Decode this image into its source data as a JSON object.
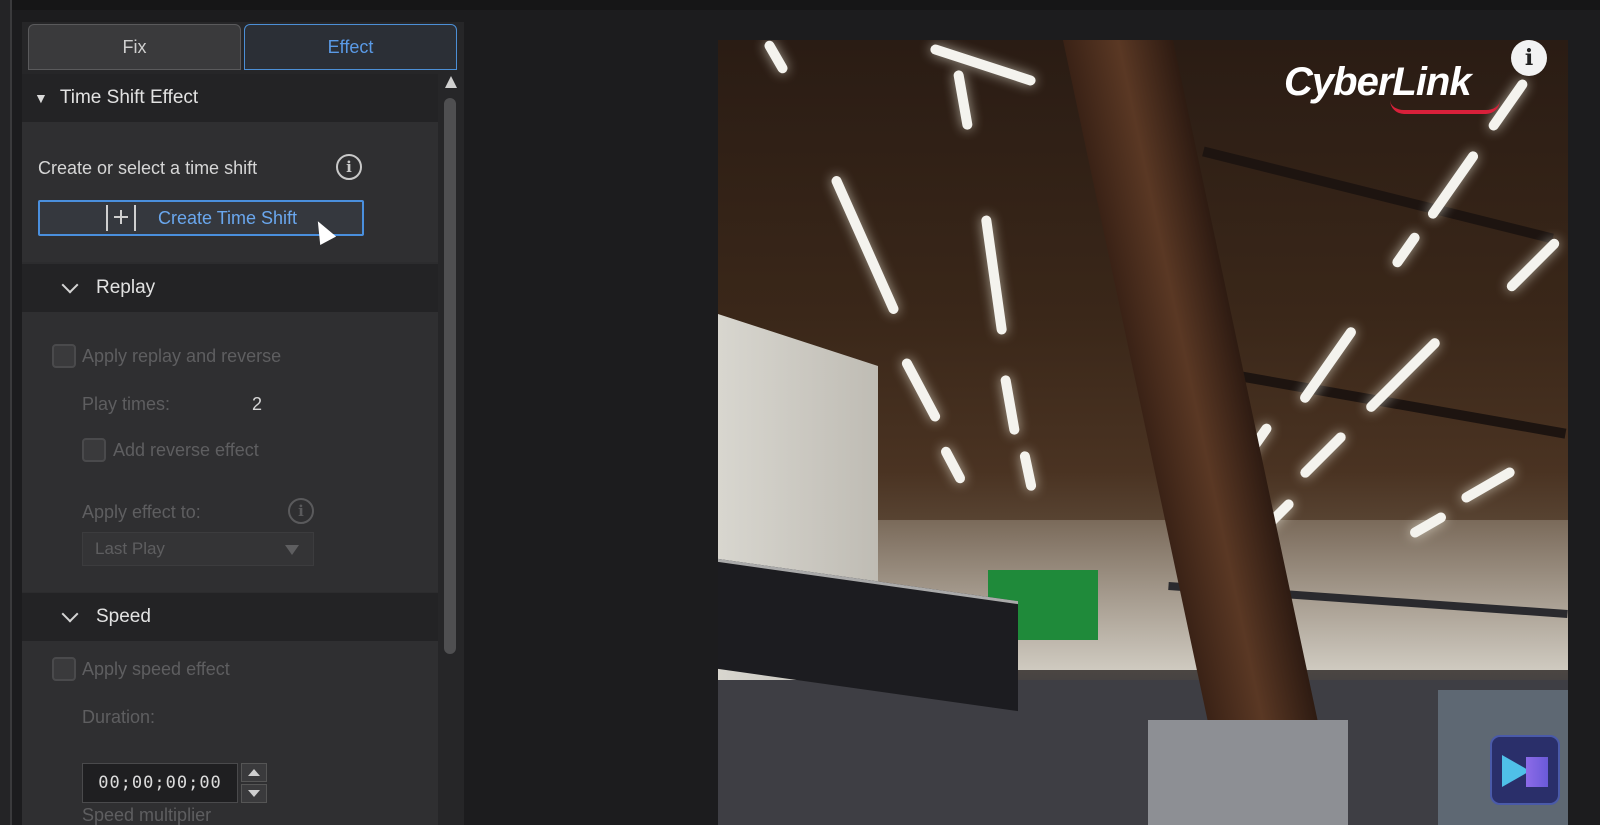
{
  "tabs": {
    "fix": "Fix",
    "effect": "Effect"
  },
  "time_shift": {
    "title": "Time Shift Effect",
    "prompt": "Create or select a time shift",
    "create_button": "Create Time Shift"
  },
  "replay": {
    "title": "Replay",
    "apply_label": "Apply replay and reverse",
    "play_times_label": "Play times:",
    "play_times_value": "2",
    "reverse_label": "Add reverse effect",
    "apply_to_label": "Apply effect to:",
    "apply_to_value": "Last Play"
  },
  "speed": {
    "title": "Speed",
    "apply_label": "Apply speed effect",
    "duration_label": "Duration:",
    "duration_value": "00;00;00;00",
    "multiplier_label": "Speed multiplier"
  },
  "preview": {
    "logo_text": "CyberLink",
    "info_glyph": "i"
  },
  "colors": {
    "accent": "#4a8fdd",
    "panel_bg": "#2c2c2e",
    "brand_red": "#d8203a"
  },
  "icons": [
    "info-icon",
    "collapse-triangle-icon",
    "chevron-down-icon",
    "add-time-shift-icon",
    "mouse-cursor-icon",
    "scroll-up-arrow-icon",
    "spin-up-icon",
    "spin-down-icon",
    "dropdown-arrow-icon",
    "app-badge-icon"
  ]
}
